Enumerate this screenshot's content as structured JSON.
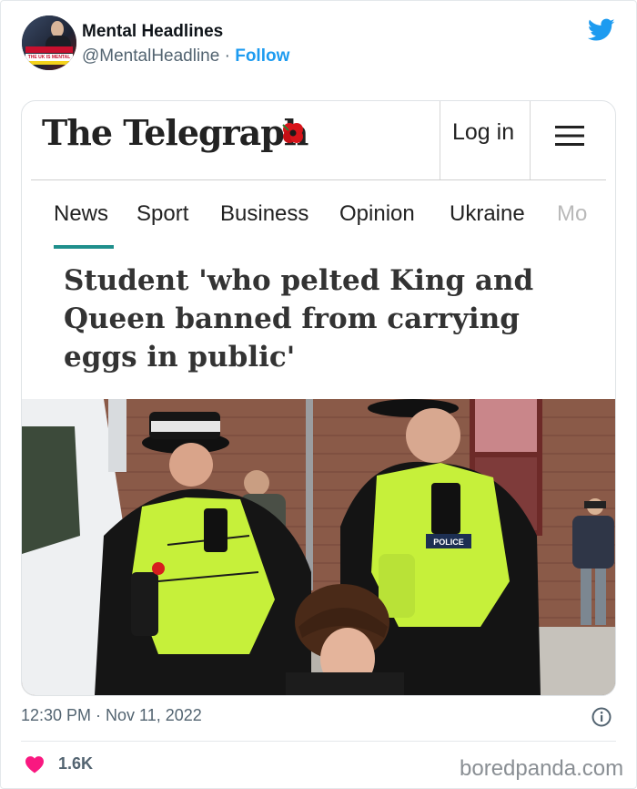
{
  "tweet": {
    "display_name": "Mental Headlines",
    "handle": "@MentalHeadline",
    "separator": "·",
    "follow_label": "Follow",
    "timestamp": "12:30 PM · Nov 11, 2022",
    "likes": "1.6K",
    "avatar_text": "THE UK IS MENTAL"
  },
  "article": {
    "brand": "The Telegraph",
    "login_label": "Log in",
    "nav": [
      "News",
      "Sport",
      "Business",
      "Opinion",
      "Ukraine",
      "Mo"
    ],
    "active_nav": "News",
    "headline": "Student 'who pelted King and Queen banned from carrying eggs in public'",
    "photo_vest_label": "POLICE"
  },
  "watermark": "boredpanda.com",
  "colors": {
    "twitter_blue": "#1d9bf0",
    "like_pink": "#f91880",
    "telegraph_teal": "#1f8f8c",
    "text_gray": "#536471"
  },
  "icons": [
    "twitter-bird-icon",
    "poppy-icon",
    "hamburger-menu-icon",
    "info-icon",
    "heart-icon"
  ]
}
